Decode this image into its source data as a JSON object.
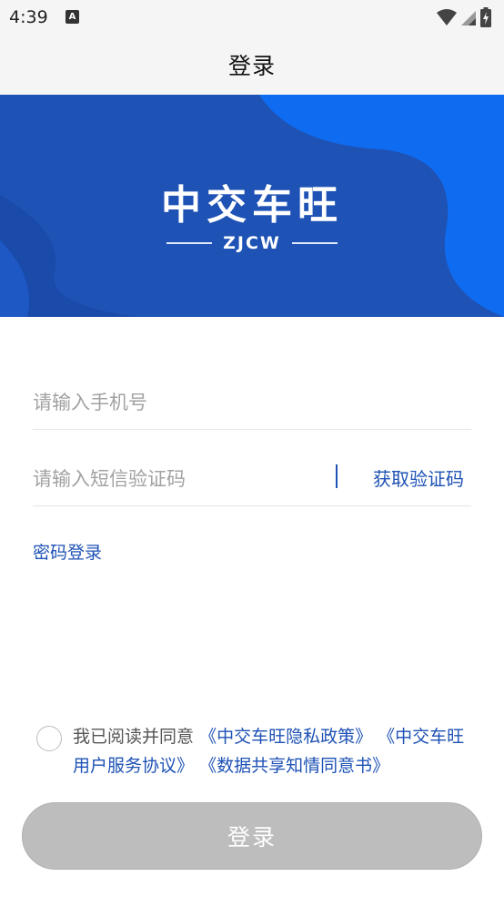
{
  "status_bar": {
    "time": "4:39",
    "notification_icon_letter": "A"
  },
  "header": {
    "title": "登录"
  },
  "banner": {
    "brand_name": "中交车旺",
    "brand_abbr": "ZJCW",
    "colors": {
      "base": "#1e52b5",
      "accent": "#0f6cf0"
    }
  },
  "form": {
    "phone_placeholder": "请输入手机号",
    "code_placeholder": "请输入短信验证码",
    "get_code_label": "获取验证码",
    "password_login_label": "密码登录"
  },
  "agreement": {
    "prefix": "我已阅读并同意",
    "privacy_link": "《中交车旺隐私政策》",
    "service_link": "《中交车旺用户服务协议》",
    "data_link": "《数据共享知情同意书》",
    "checked": false
  },
  "login_button": {
    "label": "登录",
    "enabled": false
  }
}
